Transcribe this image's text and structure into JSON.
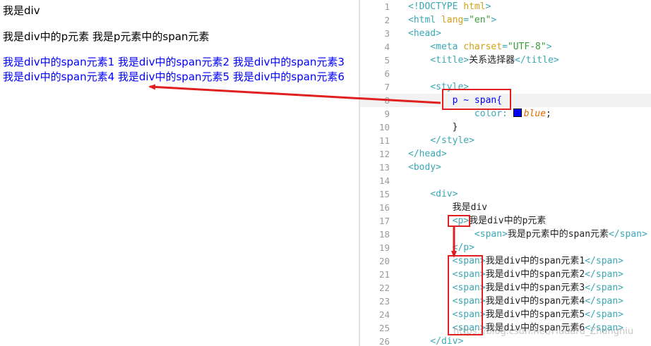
{
  "preview": {
    "line1": "我是div",
    "line2": "我是div中的p元素 我是p元素中的span元素",
    "line3": "我是div中的span元素1 我是div中的span元素2 我是div中的span元素3 我是div中的span元素4 我是div中的span元素5 我是div中的span元素6"
  },
  "editor": {
    "lines": [
      {
        "num": "1",
        "parts": [
          [
            "tag",
            "<!DOCTYPE "
          ],
          [
            "attr",
            "html"
          ],
          [
            "tag",
            ">"
          ]
        ]
      },
      {
        "num": "2",
        "parts": [
          [
            "tag",
            "<html "
          ],
          [
            "attr",
            "lang"
          ],
          [
            "tag",
            "="
          ],
          [
            "str",
            "\"en\""
          ],
          [
            "tag",
            ">"
          ]
        ]
      },
      {
        "num": "3",
        "parts": [
          [
            "tag",
            "<head>"
          ]
        ]
      },
      {
        "num": "4",
        "parts": [
          [
            "txt",
            "    "
          ],
          [
            "tag",
            "<meta "
          ],
          [
            "attr",
            "charset"
          ],
          [
            "tag",
            "="
          ],
          [
            "str",
            "\"UTF-8\""
          ],
          [
            "tag",
            ">"
          ]
        ]
      },
      {
        "num": "5",
        "parts": [
          [
            "txt",
            "    "
          ],
          [
            "tag",
            "<title>"
          ],
          [
            "txt",
            "关系选择器"
          ],
          [
            "tag",
            "</title>"
          ]
        ]
      },
      {
        "num": "6",
        "parts": []
      },
      {
        "num": "7",
        "parts": [
          [
            "txt",
            "    "
          ],
          [
            "tag",
            "<style>"
          ]
        ]
      },
      {
        "num": "8",
        "parts": [
          [
            "txt",
            "        "
          ],
          [
            "sel",
            "p ~ span{"
          ]
        ]
      },
      {
        "num": "9",
        "parts": [
          [
            "txt",
            "            "
          ],
          [
            "prop",
            "color: "
          ],
          [
            "swatch",
            ""
          ],
          [
            "kw",
            "blue"
          ],
          [
            "txt",
            ";"
          ]
        ]
      },
      {
        "num": "10",
        "parts": [
          [
            "txt",
            "        }"
          ]
        ]
      },
      {
        "num": "11",
        "parts": [
          [
            "txt",
            "    "
          ],
          [
            "tag",
            "</style>"
          ]
        ]
      },
      {
        "num": "12",
        "parts": [
          [
            "tag",
            "</head>"
          ]
        ]
      },
      {
        "num": "13",
        "parts": [
          [
            "tag",
            "<body>"
          ]
        ]
      },
      {
        "num": "14",
        "parts": []
      },
      {
        "num": "15",
        "parts": [
          [
            "txt",
            "    "
          ],
          [
            "tag",
            "<div>"
          ]
        ]
      },
      {
        "num": "16",
        "parts": [
          [
            "txt",
            "        我是div"
          ]
        ]
      },
      {
        "num": "17",
        "parts": [
          [
            "txt",
            "        "
          ],
          [
            "tag",
            "<p>"
          ],
          [
            "txt",
            "我是div中的p元素"
          ]
        ]
      },
      {
        "num": "18",
        "parts": [
          [
            "txt",
            "            "
          ],
          [
            "tag",
            "<span>"
          ],
          [
            "txt",
            "我是p元素中的span元素"
          ],
          [
            "tag",
            "</span>"
          ]
        ]
      },
      {
        "num": "19",
        "parts": [
          [
            "txt",
            "        "
          ],
          [
            "tag",
            "</p>"
          ]
        ]
      },
      {
        "num": "20",
        "parts": [
          [
            "txt",
            "        "
          ],
          [
            "tag",
            "<span>"
          ],
          [
            "txt",
            "我是div中的span元素1"
          ],
          [
            "tag",
            "</span>"
          ]
        ]
      },
      {
        "num": "21",
        "parts": [
          [
            "txt",
            "        "
          ],
          [
            "tag",
            "<span>"
          ],
          [
            "txt",
            "我是div中的span元素2"
          ],
          [
            "tag",
            "</span>"
          ]
        ]
      },
      {
        "num": "22",
        "parts": [
          [
            "txt",
            "        "
          ],
          [
            "tag",
            "<span>"
          ],
          [
            "txt",
            "我是div中的span元素3"
          ],
          [
            "tag",
            "</span>"
          ]
        ]
      },
      {
        "num": "23",
        "parts": [
          [
            "txt",
            "        "
          ],
          [
            "tag",
            "<span>"
          ],
          [
            "txt",
            "我是div中的span元素4"
          ],
          [
            "tag",
            "</span>"
          ]
        ]
      },
      {
        "num": "24",
        "parts": [
          [
            "txt",
            "        "
          ],
          [
            "tag",
            "<span>"
          ],
          [
            "txt",
            "我是div中的span元素5"
          ],
          [
            "tag",
            "</span>"
          ]
        ]
      },
      {
        "num": "25",
        "parts": [
          [
            "txt",
            "        "
          ],
          [
            "tag",
            "<span>"
          ],
          [
            "txt",
            "我是div中的span元素6"
          ],
          [
            "tag",
            "</span>"
          ]
        ]
      },
      {
        "num": "26",
        "parts": [
          [
            "txt",
            "    "
          ],
          [
            "tag",
            "</div>"
          ]
        ]
      }
    ],
    "active_line": "8"
  },
  "watermark": "https://blog.csdn.net/Hudaru_Zhangniu",
  "colors": {
    "annotation": "#e02020",
    "preview_span": "#0000ff"
  }
}
